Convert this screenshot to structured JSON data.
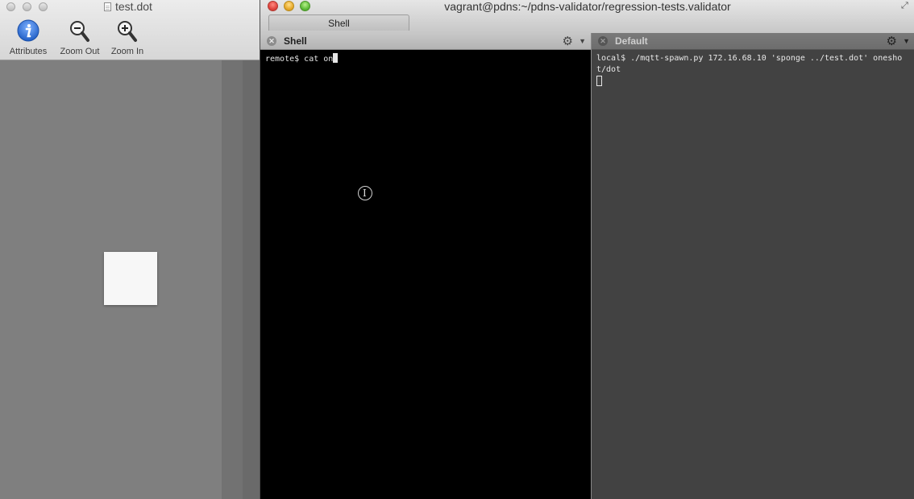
{
  "viewer": {
    "title": "test.dot",
    "toolbar": [
      {
        "label": "Attributes",
        "icon": "info-icon"
      },
      {
        "label": "Zoom Out",
        "icon": "zoom-out-icon"
      },
      {
        "label": "Zoom In",
        "icon": "zoom-in-icon"
      }
    ]
  },
  "terminal": {
    "title": "vagrant@pdns:~/pdns-validator/regression-tests.validator",
    "window_tab": "Shell",
    "panes": [
      {
        "title": "Shell",
        "prompt": "remote$ ",
        "input": "cat on"
      },
      {
        "title": "Default",
        "prompt": "local$ ",
        "command": "./mqtt-spawn.py 172.16.68.10 'sponge ../test.dot' oneshot/dot"
      }
    ]
  },
  "colors": {
    "close": "#e0443e",
    "minimize": "#e7a92b",
    "maximize": "#5fbd3a",
    "info_icon": "#2f6fd6"
  }
}
